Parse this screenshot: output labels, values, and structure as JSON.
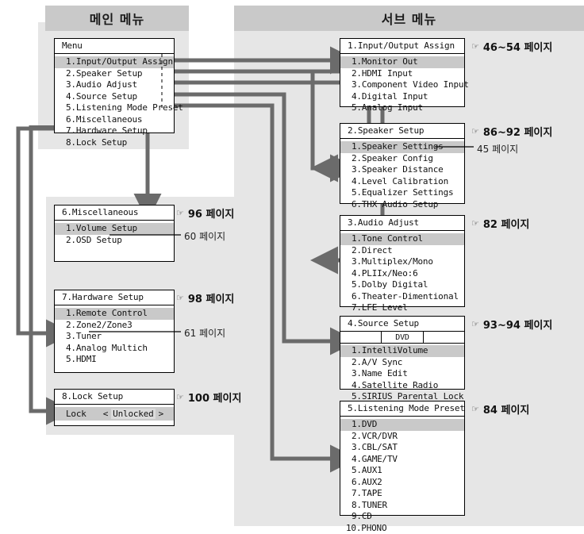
{
  "headers": {
    "main": "메인 메뉴",
    "sub": "서브 메뉴"
  },
  "icons": {
    "hand": "☞",
    "arrow_left": "<",
    "arrow_right": ">"
  },
  "main_menu": {
    "title": "Menu",
    "items": [
      "1.Input/Output Assign",
      "2.Speaker Setup",
      "3.Audio Adjust",
      "4.Source Setup",
      "5.Listening Mode Preset",
      "6.Miscellaneous",
      "7.Hardware Setup",
      "8.Lock Setup"
    ],
    "highlighted_index": 0
  },
  "left_panels": [
    {
      "title": "6.Miscellaneous",
      "items": [
        "1.Volume Setup",
        "2.OSD Setup"
      ],
      "highlighted_index": 0,
      "page_ref": "96 페이지",
      "sub_ref": "60 페이지"
    },
    {
      "title": "7.Hardware Setup",
      "items": [
        "1.Remote Control",
        "2.Zone2/Zone3",
        "3.Tuner",
        "4.Analog Multich",
        "5.HDMI"
      ],
      "highlighted_index": 0,
      "page_ref": "98 페이지",
      "sub_ref": "61 페이지"
    },
    {
      "title": "8.Lock Setup",
      "lock_label": "Lock",
      "lock_value": "Unlocked",
      "page_ref": "100 페이지"
    }
  ],
  "sub_panels": [
    {
      "title": "1.Input/Output Assign",
      "items": [
        "1.Monitor Out",
        "2.HDMI Input",
        "3.Component Video Input",
        "4.Digital Input",
        "5.Analog Input"
      ],
      "highlighted_index": 0,
      "page_ref": "46~54 페이지"
    },
    {
      "title": "2.Speaker Setup",
      "items": [
        "1.Speaker Settings",
        "2.Speaker Config",
        "3.Speaker Distance",
        "4.Level Calibration",
        "5.Equalizer Settings",
        "6.THX Audio Setup"
      ],
      "highlighted_index": 0,
      "page_ref": "86~92 페이지",
      "sub_ref": "45 페이지"
    },
    {
      "title": "3.Audio Adjust",
      "items": [
        "1.Tone Control",
        "2.Direct",
        "3.Multiplex/Mono",
        "4.PLIIx/Neo:6",
        "5.Dolby Digital",
        "6.Theater-Dimentional",
        "7.LFE Level"
      ],
      "highlighted_index": 0,
      "page_ref": "82 페이지"
    },
    {
      "title": "4.Source Setup",
      "source_label": "DVD",
      "items": [
        "1.IntelliVolume",
        "2.A/V Sync",
        "3.Name Edit",
        "4.Satellite Radio",
        "5.SIRIUS Parental Lock"
      ],
      "highlighted_index": 0,
      "page_ref": "93~94 페이지"
    },
    {
      "title": "5.Listening Mode Preset",
      "items": [
        "1.DVD",
        "2.VCR/DVR",
        "3.CBL/SAT",
        "4.GAME/TV",
        "5.AUX1",
        "6.AUX2",
        "7.TAPE",
        "8.TUNER",
        "9.CD",
        "10.PHONO"
      ],
      "highlighted_index": 0,
      "page_ref": "84 페이지"
    }
  ],
  "colors": {
    "band": "#c9c9c9",
    "panel": "#e6e6e6",
    "highlight": "#c9c9c9",
    "connector": "#6b6b6b",
    "box_border": "#000000"
  }
}
